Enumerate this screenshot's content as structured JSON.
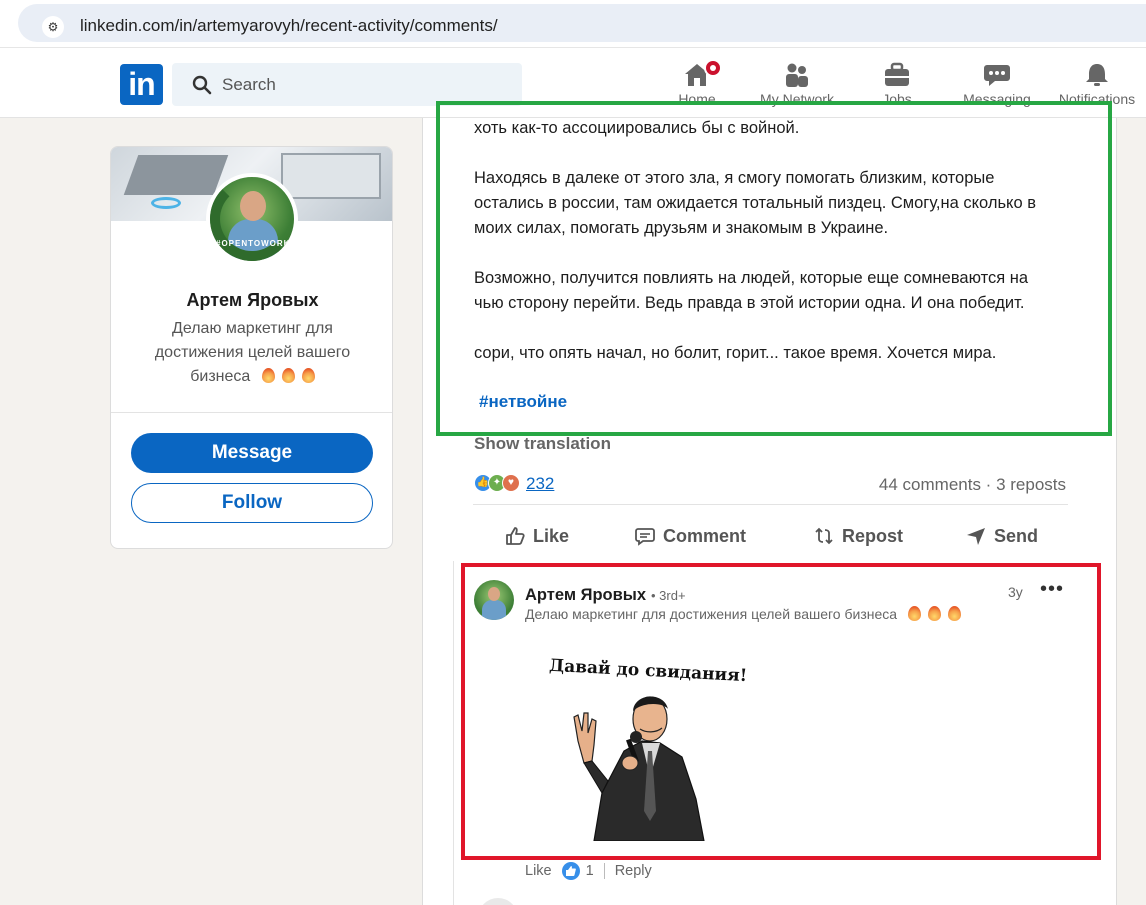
{
  "browser": {
    "url": "linkedin.com/in/artemyarovyh/recent-activity/comments/",
    "site_icon": "site-settings-icon"
  },
  "nav": {
    "logo": "in",
    "search_placeholder": "Search",
    "items": [
      {
        "label": "Home",
        "icon": "home-icon",
        "has_badge": true
      },
      {
        "label": "My Network",
        "icon": "network-icon"
      },
      {
        "label": "Jobs",
        "icon": "briefcase-icon"
      },
      {
        "label": "Messaging",
        "icon": "messaging-icon"
      },
      {
        "label": "Notifications",
        "icon": "bell-icon"
      }
    ],
    "colors": {
      "brand": "#0a66c2",
      "badge": "#cb112d"
    }
  },
  "profile": {
    "name": "Артем Яровых",
    "headline": "Делаю маркетинг для достижения целей вашего бизнеса",
    "avatar_frame_text": "#OPENTOWORK",
    "message_label": "Message",
    "follow_label": "Follow"
  },
  "post": {
    "lines": [
      "хоть как-то ассоциировались бы с войной.",
      "Находясь в далеке от этого зла, я смогу помогать близким, которые",
      "остались в россии, там ожидается тотальный пиздец. Смогу,на сколько в",
      "моих силах, помогать друзьям и знакомым в Украине.",
      "Возможно, получится повлиять на людей, которые еще сомневаются на",
      "чью сторону перейти. Ведь правда в этой истории одна. И она победит.",
      "сори, что опять начал, но болит, горит... такое время. Хочется мира."
    ],
    "hashtag": "#нетвойне",
    "show_translation": "Show translation",
    "reaction_count": "232",
    "stats": "44 comments · 3 reposts",
    "actions": {
      "like": "Like",
      "comment": "Comment",
      "repost": "Repost",
      "send": "Send"
    }
  },
  "comment": {
    "author": "Артем Яровых",
    "degree": "• 3rd+",
    "time": "3y",
    "more": "•••",
    "headline": "Делаю маркетинг для достижения целей вашего бизнеса",
    "image_caption": "Давай до свидания!",
    "like_label": "Like",
    "like_count": "1",
    "reply_label": "Reply"
  },
  "annotations": {
    "green_box_color": "#27a744",
    "red_box_color": "#e0162a"
  }
}
